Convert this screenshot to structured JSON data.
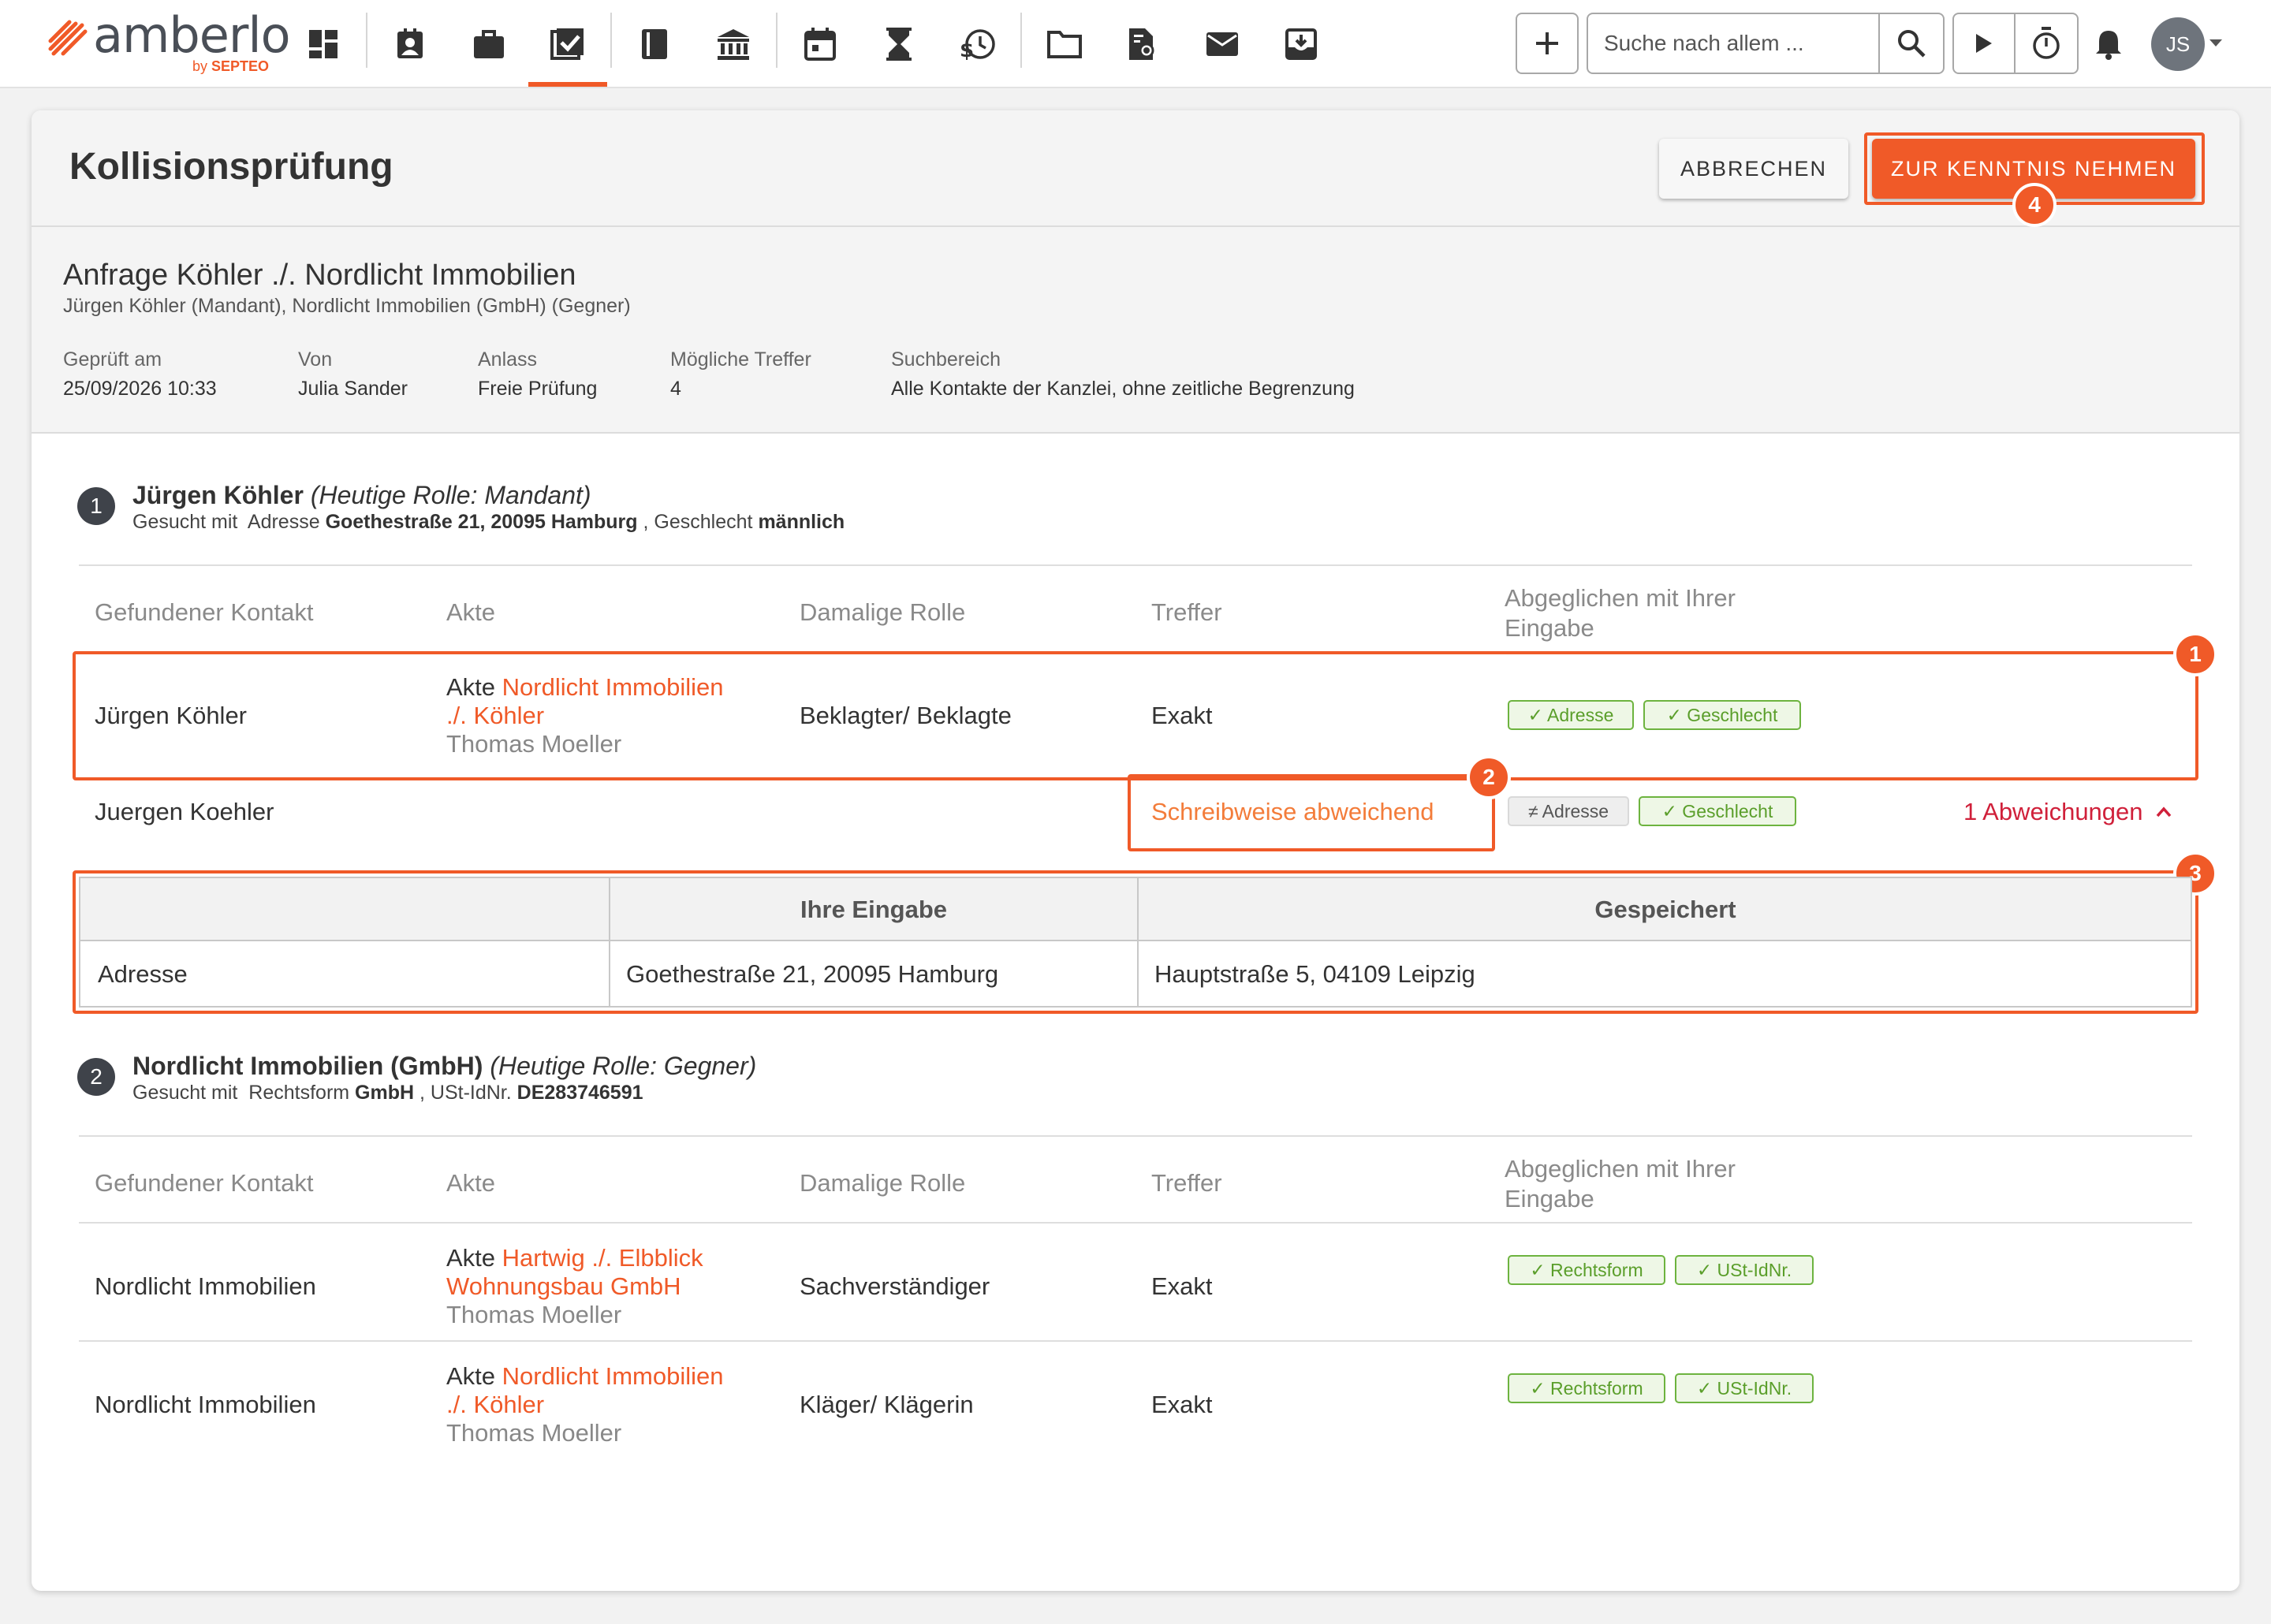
{
  "app": {
    "brand": "amberlo",
    "by_prefix": "by",
    "by_company": "SEPTEO",
    "nav_icons": [
      "dashboard-icon",
      "contacts-icon",
      "briefcase-icon",
      "tasks-check-icon",
      "book-icon",
      "bank-icon",
      "calendar-icon",
      "hourglass-icon",
      "time-money-icon",
      "folder-icon",
      "document-search-icon",
      "mail-icon",
      "inbox-download-icon"
    ],
    "search_placeholder": "Suche nach allem ...",
    "user_initials": "JS"
  },
  "page": {
    "title": "Kollisionsprüfung",
    "cancel_label": "ABBRECHEN",
    "ack_label": "ZUR KENNTNIS NEHMEN",
    "ack_marker": "4"
  },
  "request": {
    "title": "Anfrage Köhler ./. Nordlicht Immobilien",
    "subtitle": "Jürgen Köhler (Mandant), Nordlicht Immobilien (GmbH) (Gegner)",
    "meta": [
      {
        "label": "Geprüft am",
        "value": "25/09/2026 10:33"
      },
      {
        "label": "Von",
        "value": "Julia Sander"
      },
      {
        "label": "Anlass",
        "value": "Freie Prüfung"
      },
      {
        "label": "Mögliche Treffer",
        "value": "4"
      },
      {
        "label": "Suchbereich",
        "value": "Alle Kontakte der Kanzlei, ohne zeitliche Begrenzung"
      }
    ]
  },
  "columns": {
    "contact": "Gefundener Kontakt",
    "file": "Akte",
    "role": "Damalige Rolle",
    "hit": "Treffer",
    "match_l1": "Abgeglichen mit Ihrer",
    "match_l2": "Eingabe"
  },
  "sections": [
    {
      "index": "1",
      "name": "Jürgen Köhler",
      "role": "(Heutige Rolle: Mandant)",
      "searched_with": "Gesucht mit",
      "criteria_1_label": "Adresse",
      "criteria_1_value": "Goethestraße 21, 20095 Hamburg",
      "criteria_sep": ",",
      "criteria_2_label": "Geschlecht",
      "criteria_2_value": "männlich",
      "rows": [
        {
          "contact": "Jürgen Köhler",
          "file_prefix": "Akte",
          "file_link_1": "Nordlicht Immobilien",
          "file_link_2": "./. Köhler",
          "owner": "Thomas Moeller",
          "role": "Beklagter/ Beklagte",
          "hit": "Exakt",
          "tags": [
            "✓ Adresse",
            "✓ Geschlecht"
          ],
          "marker": "1"
        },
        {
          "contact": "Juergen Koehler",
          "hit": "Schreibweise abweichend",
          "tags": [
            "≠ Adresse",
            "✓ Geschlecht"
          ],
          "deviations": "1 Abweichungen",
          "marker": "2"
        }
      ],
      "diff": {
        "marker": "3",
        "header_input": "Ihre Eingabe",
        "header_saved": "Gespeichert",
        "field": "Adresse",
        "input_value": "Goethestraße 21, 20095 Hamburg",
        "saved_value": "Hauptstraße 5, 04109 Leipzig"
      }
    },
    {
      "index": "2",
      "name": "Nordlicht Immobilien (GmbH)",
      "role": "(Heutige Rolle: Gegner)",
      "searched_with": "Gesucht mit",
      "criteria_1_label": "Rechtsform",
      "criteria_1_value": "GmbH",
      "criteria_sep": ",",
      "criteria_2_label": "USt-IdNr.",
      "criteria_2_value": "DE283746591",
      "rows": [
        {
          "contact": "Nordlicht Immobilien",
          "file_prefix": "Akte",
          "file_link_1": "Hartwig ./. Elbblick",
          "file_link_2": "Wohnungsbau GmbH",
          "owner": "Thomas Moeller",
          "role": "Sachverständiger",
          "hit": "Exakt",
          "tags": [
            "✓ Rechtsform",
            "✓ USt-IdNr."
          ]
        },
        {
          "contact": "Nordlicht Immobilien",
          "file_prefix": "Akte",
          "file_link_1": "Nordlicht Immobilien",
          "file_link_2": "./. Köhler",
          "owner": "Thomas Moeller",
          "role": "Kläger/ Klägerin",
          "hit": "Exakt",
          "tags": [
            "✓ Rechtsform",
            "✓ USt-IdNr."
          ]
        }
      ]
    }
  ],
  "colors": {
    "accent": "#f05a28",
    "dark": "#3f434a",
    "match_green": "#6db33f",
    "deviation_red": "#d0203a"
  }
}
